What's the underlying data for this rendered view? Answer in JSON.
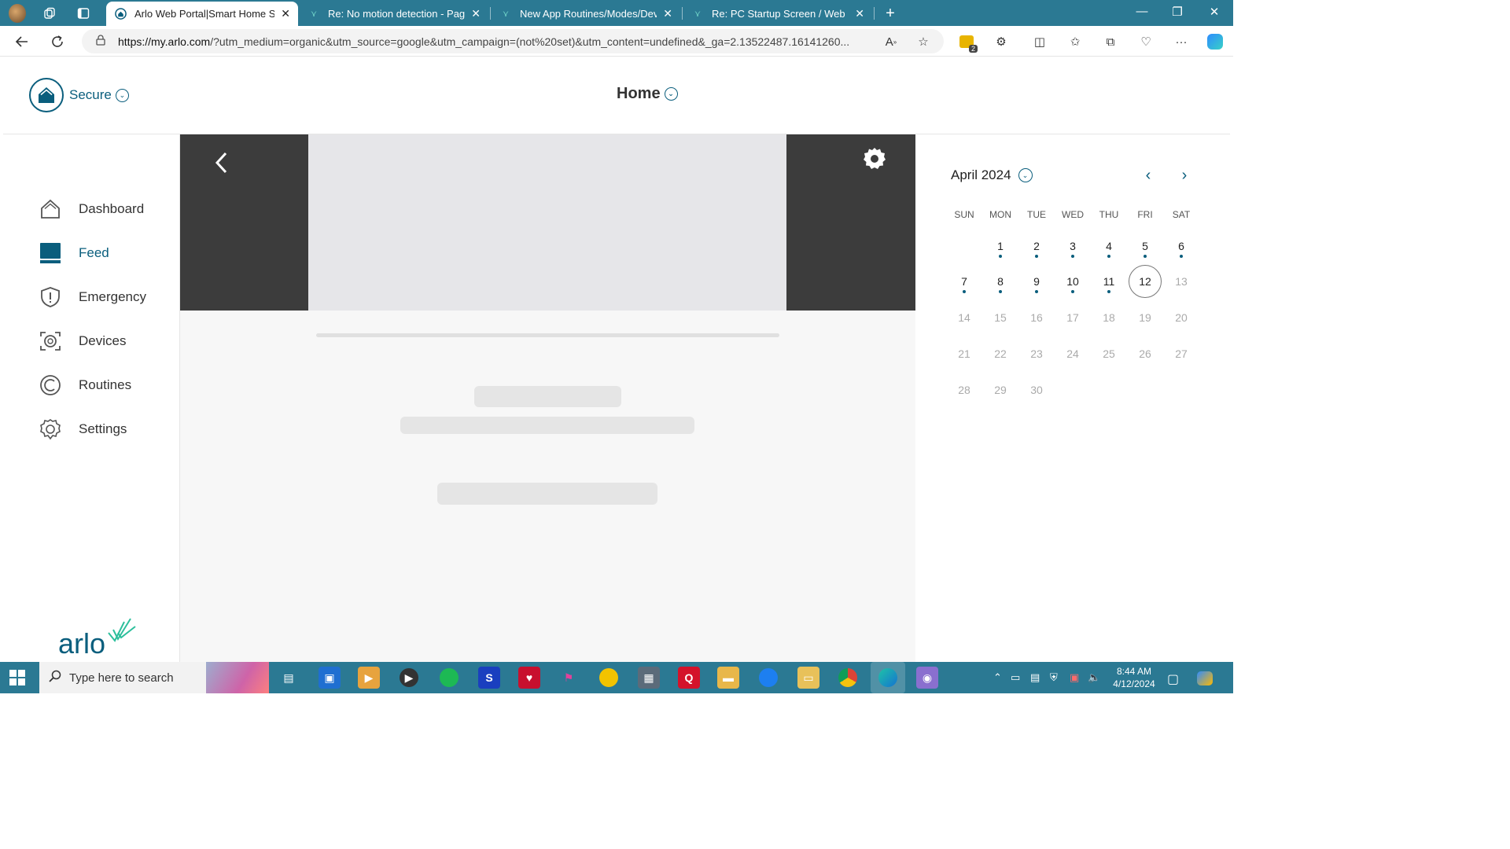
{
  "browser": {
    "tabs": [
      {
        "title": "Arlo Web Portal|Smart Home Sec",
        "active": true
      },
      {
        "title": "Re: No motion detection - Page",
        "active": false
      },
      {
        "title": "New App Routines/Modes/Devic",
        "active": false
      },
      {
        "title": "Re: PC Startup Screen / Web Port",
        "active": false
      }
    ],
    "url_host": "https://my.arlo.com",
    "url_rest": "/?utm_medium=organic&utm_source=google&utm_campaign=(not%20set)&utm_content=undefined&_ga=2.13522487.16141260...",
    "badge_count": "2"
  },
  "header": {
    "secure_label": "Secure",
    "home_title": "Home"
  },
  "sidebar": {
    "items": [
      {
        "label": "Dashboard",
        "icon": "home-icon"
      },
      {
        "label": "Feed",
        "icon": "feed-icon"
      },
      {
        "label": "Emergency",
        "icon": "shield-alert-icon"
      },
      {
        "label": "Devices",
        "icon": "camera-icon"
      },
      {
        "label": "Routines",
        "icon": "routines-icon"
      },
      {
        "label": "Settings",
        "icon": "gear-icon"
      }
    ],
    "active": "Feed",
    "logo_text": "arlo"
  },
  "calendar": {
    "month_label": "April 2024",
    "weekdays": [
      "SUN",
      "MON",
      "TUE",
      "WED",
      "THU",
      "FRI",
      "SAT"
    ],
    "today": 12,
    "first_weekday": 1,
    "days_in_month": 30,
    "days_with_events": [
      1,
      2,
      3,
      4,
      5,
      6,
      7,
      8,
      9,
      10,
      11
    ],
    "accent_color": "#0a5e7d"
  },
  "taskbar": {
    "search_placeholder": "Type here to search",
    "time": "8:44 AM",
    "date": "4/12/2024"
  }
}
